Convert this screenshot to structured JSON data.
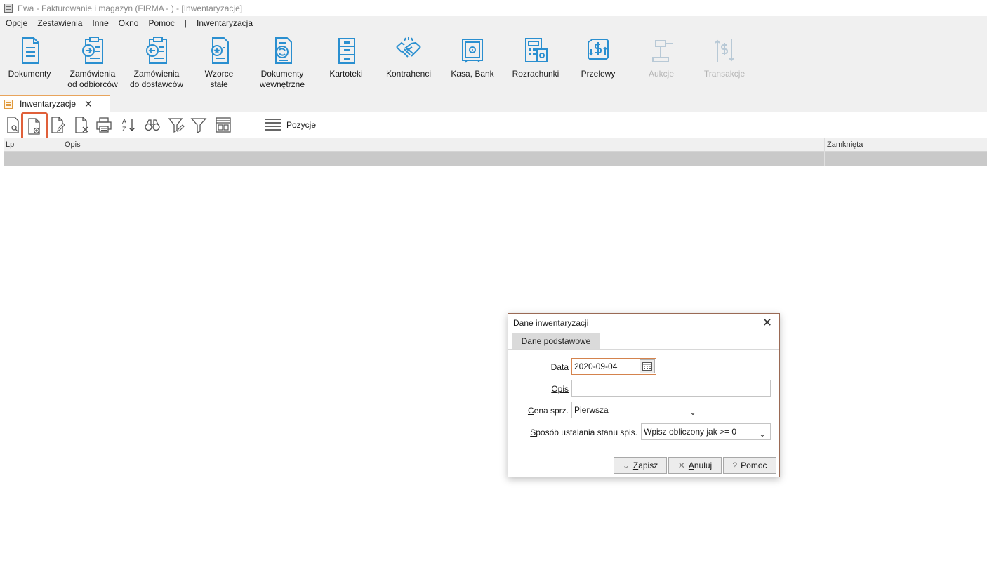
{
  "window": {
    "title": "Ewa - Fakturowanie i magazyn (FIRMA - ) - [Inwentaryzacje]"
  },
  "menu": [
    {
      "label": "Opcje",
      "u": "c"
    },
    {
      "label": "Zestawienia",
      "u": "Z"
    },
    {
      "label": "Inne",
      "u": "I"
    },
    {
      "label": "Okno",
      "u": "O"
    },
    {
      "label": "Pomoc",
      "u": "P"
    },
    {
      "label": "|"
    },
    {
      "label": "Inwentaryzacja",
      "u": "I"
    }
  ],
  "ribbon": {
    "dokumenty": "Dokumenty",
    "zam_odb_1": "Zamówienia",
    "zam_odb_2": "od odbiorców",
    "zam_dost_1": "Zamówienia",
    "zam_dost_2": "do dostawców",
    "wzorce_1": "Wzorce",
    "wzorce_2": "stałe",
    "dok_wew_1": "Dokumenty",
    "dok_wew_2": "wewnętrzne",
    "kartoteki": "Kartoteki",
    "kontrahenci": "Kontrahenci",
    "kasa": "Kasa, Bank",
    "rozrachunki": "Rozrachunki",
    "przelewy": "Przelewy",
    "aukcje": "Aukcje",
    "transakcje": "Transakcje"
  },
  "tab": {
    "label": "Inwentaryzacje",
    "close": "✕"
  },
  "toolbar": {
    "pozycje": "Pozycje"
  },
  "grid": {
    "columns": [
      "Lp",
      "Opis",
      "Zamknięta"
    ]
  },
  "dialog": {
    "title": "Dane inwentaryzacji",
    "close": "✕",
    "tab": "Dane podstawowe",
    "data_label": "Data",
    "data_value": "2020-09-04",
    "opis_label": "Opis",
    "opis_value": "",
    "cena_label": "Cena sprz.",
    "cena_value": "Pierwsza",
    "sposob_label": "Sposób ustalania stanu spis.",
    "sposob_value": "Wpisz obliczony jak >= 0",
    "zapisz": "Zapisz",
    "anuluj": "Anuluj",
    "pomoc": "Pomoc"
  },
  "colors": {
    "icon_blue": "#2a8fd0",
    "icon_disabled": "#b8c9d6",
    "highlight": "#e0603a",
    "tab_accent": "#e8a45c"
  }
}
